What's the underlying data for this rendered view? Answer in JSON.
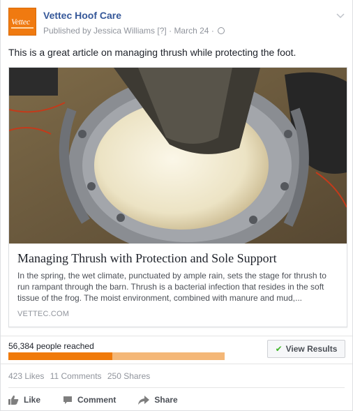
{
  "post": {
    "page_name": "Vettec Hoof Care",
    "logo_text": "Vettec",
    "published_by": "Published by Jessica Williams",
    "published_hint": "[?]",
    "sep": "·",
    "date": "March 24",
    "sep2": "·",
    "text": "This is a great article on managing thrush while protecting the foot.",
    "chevron_icon": "chevron-down-icon",
    "audience_icon": "globe-icon"
  },
  "link": {
    "title": "Managing Thrush with Protection and Sole Support",
    "description": "In the spring, the wet climate, punctuated by ample rain, sets the stage for thrush to run rampant through the barn. Thrush is a bacterial infection that resides in the soft tissue of the frog. The moist environment, combined with manure and mud,...",
    "domain": "VETTEC.COM",
    "image_icon": "horse-hoof-photo"
  },
  "insights": {
    "reached": "56,384 people reached",
    "organic_fraction": 0.48,
    "view_results": "View Results",
    "colors": {
      "organic": "#f07a0a",
      "paid": "#f4b777"
    }
  },
  "engagement": {
    "likes": "423 Likes",
    "comments": "11 Comments",
    "shares": "250 Shares"
  },
  "actions": {
    "like": "Like",
    "comment": "Comment",
    "share": "Share"
  }
}
